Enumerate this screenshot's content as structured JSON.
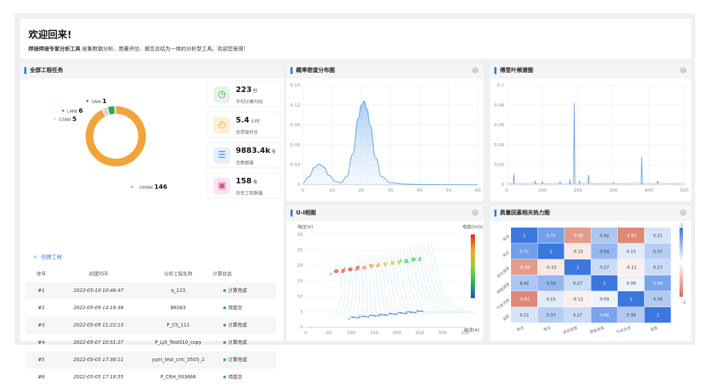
{
  "welcome": {
    "title": "欢迎回来!",
    "tool_name": "焊接焊接专家分析工具",
    "subtitle": "是集数据分析、质量评估、报告总结为一体的分析型工具。欢迎您使用!"
  },
  "tasks": {
    "title": "全部工程任务",
    "donut": [
      {
        "label": "GMAW",
        "value": 146,
        "color": "#f2a33a"
      },
      {
        "label": "GTAW",
        "value": 5,
        "color": "#d8d8d8"
      },
      {
        "label": "LMW",
        "value": 6,
        "color": "#2fa84f"
      },
      {
        "label": "SAW",
        "value": 1,
        "color": "#3b86e0"
      }
    ],
    "stats": [
      {
        "value": "223",
        "unit": "秒",
        "label": "平均计算时间",
        "icon": "clock-icon",
        "bg": "#e6f4e6",
        "fg": "#3c9c3c"
      },
      {
        "value": "5.4",
        "unit": "小时",
        "label": "总焊接时长",
        "icon": "timer-icon",
        "bg": "#fdf0d8",
        "fg": "#f0a020"
      },
      {
        "value": "9883.4k",
        "unit": "条",
        "label": "总数据量",
        "icon": "database-icon",
        "bg": "#e3effc",
        "fg": "#3a88e0"
      },
      {
        "value": "158",
        "unit": "条",
        "label": "历史工程数量",
        "icon": "image-icon",
        "bg": "#fbe4ef",
        "fg": "#d4508a"
      }
    ],
    "create_label": "创建工程",
    "columns": [
      "序号",
      "创建时间",
      "分析工程名称",
      "计算状态"
    ],
    "rows": [
      {
        "id": "#1",
        "time": "2022-05-10 10:46:47",
        "name": "q_123",
        "status": "计算完成",
        "color": "#3aa64c"
      },
      {
        "id": "#2",
        "time": "2022-05-09 14:16:38",
        "name": "B6563",
        "status": "待提交",
        "color": "#2b94e0"
      },
      {
        "id": "#3",
        "time": "2022-05-09 11:22:13",
        "name": "P_CS_111",
        "status": "计算完成",
        "color": "#3aa64c"
      },
      {
        "id": "#4",
        "time": "2022-05-07 10:51:27",
        "name": "P_LJX_Test010_copy",
        "status": "计算完成",
        "color": "#3aa64c"
      },
      {
        "id": "#5",
        "time": "2022-05-05 17:36:11",
        "name": "yqm_test_crrc_0505_2",
        "status": "计算完成",
        "color": "#3aa64c"
      },
      {
        "id": "#6",
        "time": "2022-05-05 17:16:55",
        "name": "P_CRH_003666",
        "status": "待提交",
        "color": "#2b94e0"
      }
    ]
  },
  "chart_data": [
    {
      "type": "area",
      "title": "概率密度分布图",
      "xlim": [
        0,
        60
      ],
      "ylim": [
        0,
        0.15
      ],
      "xticks": [
        0,
        10,
        20,
        30,
        40,
        50,
        60
      ],
      "yticks": [
        0,
        0.03,
        0.06,
        0.09,
        0.12,
        0.15
      ],
      "x": [
        0,
        2,
        4,
        5.5,
        7,
        9,
        11,
        13,
        15,
        17,
        19,
        20,
        21,
        22,
        23,
        25,
        27,
        30,
        35,
        40,
        50,
        60
      ],
      "y": [
        0.003,
        0.012,
        0.026,
        0.031,
        0.027,
        0.014,
        0.005,
        0.003,
        0.012,
        0.045,
        0.1,
        0.12,
        0.126,
        0.114,
        0.09,
        0.04,
        0.012,
        0.003,
        0.001,
        0.0005,
        0.0002,
        0.0001
      ]
    },
    {
      "type": "line",
      "title": "傅里叶频谱图",
      "xlim": [
        0,
        500
      ],
      "ylim": [
        0,
        0.1
      ],
      "xticks": [
        0,
        100,
        200,
        300,
        400,
        500
      ],
      "yticks": [
        0,
        0.02,
        0.04,
        0.06,
        0.08,
        0.1
      ],
      "peaks": [
        {
          "x": 20,
          "y": 0.011
        },
        {
          "x": 80,
          "y": 0.004
        },
        {
          "x": 100,
          "y": 0.003
        },
        {
          "x": 150,
          "y": 0.003
        },
        {
          "x": 178,
          "y": 0.005
        },
        {
          "x": 190,
          "y": 0.082
        },
        {
          "x": 205,
          "y": 0.004
        },
        {
          "x": 230,
          "y": 0.01
        },
        {
          "x": 300,
          "y": 0.002
        },
        {
          "x": 380,
          "y": 0.028
        },
        {
          "x": 425,
          "y": 0.004
        }
      ]
    },
    {
      "type": "scatter",
      "title": "U-I相图",
      "xlabel": "电流(A)",
      "ylabel": "电压(V)",
      "colorbar_label": "电阻(mΩ)",
      "xlim": [
        0,
        350
      ],
      "ylim": [
        0,
        30
      ],
      "xticks": [
        0,
        50,
        100,
        150,
        200,
        250,
        300,
        350
      ],
      "yticks": [
        0,
        5,
        10,
        15,
        20,
        25,
        30
      ]
    },
    {
      "type": "heatmap",
      "title": "质量因素相关热力图",
      "row_labels": [
        "电流",
        "电压",
        "送丝速度",
        "焊接速度",
        "气体流速",
        "温度"
      ],
      "col_labels": [
        "电流",
        "电压",
        "送丝速度",
        "焊接速度",
        "气体流速",
        "温度"
      ],
      "values": [
        [
          1,
          0.71,
          -0.68,
          0.42,
          -0.81,
          0.21
        ],
        [
          0.71,
          1,
          -0.15,
          0.54,
          0.15,
          0.37
        ],
        [
          -0.68,
          -0.15,
          1,
          0.27,
          -0.11,
          0.27
        ],
        [
          0.42,
          0.54,
          0.27,
          1,
          0.09,
          0.68
        ],
        [
          -0.81,
          0.15,
          -0.11,
          0.09,
          1,
          0.39
        ],
        [
          0.21,
          0.37,
          0.27,
          0.68,
          0.39,
          1
        ]
      ],
      "scale": [
        -1,
        1
      ]
    }
  ]
}
